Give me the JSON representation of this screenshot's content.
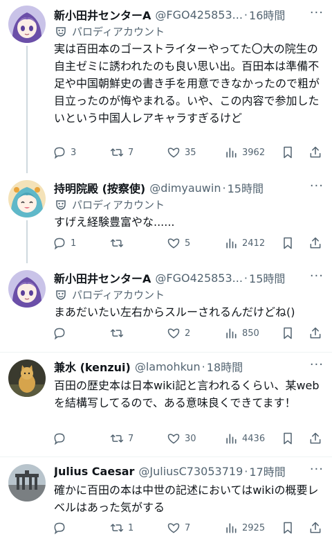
{
  "tweets": [
    {
      "name": "新小田井センターA",
      "handle": "@FGO425853...",
      "time": "16時間",
      "parody_label": "パロディアカウント",
      "text": "実は百田本のゴーストライターやってた〇大の院生の自主ゼミに誘われたのも良い思い出。百田本は準備不足や中国朝鮮史の書き手を用意できなかったので粗が目立ったのが悔やまれる。いや、この内容で参加したいという中国人レアキャラすぎるけど",
      "replies": "3",
      "retweets": "7",
      "likes": "35",
      "views": "3962"
    },
    {
      "name": "持明院殿 (按察使)",
      "handle": "@dimyauwin",
      "time": "15時間",
      "parody_label": "パロディアカウント",
      "text": "すげえ経験豊富やな......",
      "replies": "1",
      "retweets": "",
      "likes": "5",
      "views": "2412"
    },
    {
      "name": "新小田井センターA",
      "handle": "@FGO425853...",
      "time": "15時間",
      "parody_label": "パロディアカウント",
      "text": "まあだいたい左右からスルーされるんだけどね()",
      "replies": "",
      "retweets": "",
      "likes": "2",
      "views": "850"
    },
    {
      "name": "兼水 (kenzui)",
      "handle": "@lamohkun",
      "time": "18時間",
      "text": "百田の歴史本は日本wiki記と言われるくらい、某webを結構写してるので、ある意味良くできてます！",
      "replies": "",
      "retweets": "7",
      "likes": "30",
      "views": "4436"
    },
    {
      "name": "Julius Caesar",
      "handle": "@JuliusC73053719",
      "time": "17時間",
      "text": "確かに百田の本は中世の記述においてはwikiの概要レベルはあった気がする",
      "replies": "",
      "retweets": "1",
      "likes": "7",
      "views": "2925"
    }
  ],
  "more_glyph": "···",
  "dot_glyph": "·",
  "colors": {
    "text": "#0f1419",
    "secondary": "#536471",
    "divider": "#eff3f4"
  }
}
